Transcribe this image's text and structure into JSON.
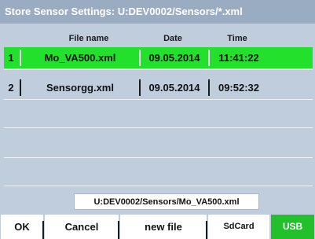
{
  "window": {
    "title": "Store Sensor Settings:  U:DEV0002/Sensors/*.xml"
  },
  "table": {
    "headers": {
      "file_name": "File name",
      "date": "Date",
      "time": "Time"
    },
    "rows": [
      {
        "index": "1",
        "file_name": "Mo_VA500.xml",
        "date": "09.05.2014",
        "time": "11:41:22",
        "selected": true
      },
      {
        "index": "2",
        "file_name": "Sensorgg.xml",
        "date": "09.05.2014",
        "time": "09:52:32",
        "selected": false
      }
    ]
  },
  "path": {
    "value": "U:DEV0002/Sensors/Mo_VA500.xml"
  },
  "buttons": {
    "ok": "OK",
    "cancel": "Cancel",
    "new_file": "new file",
    "sdcard": "SdCard",
    "usb": "USB"
  },
  "colors": {
    "titlebar": "#9aacc2",
    "panel": "#c0cddd",
    "selected_row": "#22e02c",
    "usb_active": "#22c02a"
  }
}
